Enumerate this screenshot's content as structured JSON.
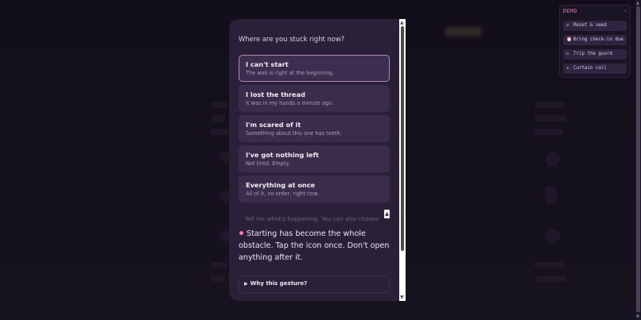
{
  "modal": {
    "question": "Where are you stuck right now?",
    "options": [
      {
        "title": "I can't start",
        "subtitle": "The wall is right at the beginning."
      },
      {
        "title": "I lost the thread",
        "subtitle": "It was in my hands a minute ago."
      },
      {
        "title": "I'm scared of it",
        "subtitle": "Something about this one has teeth."
      },
      {
        "title": "I've got nothing left",
        "subtitle": "Not tired. Empty."
      },
      {
        "title": "Everything at once",
        "subtitle": "All of it, no order, right now."
      }
    ],
    "textarea_placeholder": "Tell me what's happening. You can also choose",
    "response": "Starting has become the whole obstacle. Tap the icon once. Don't open anything after it.",
    "why_label": "Why this gesture?",
    "colors": {
      "accent_dot": "#ff6fb1",
      "selected_border": "#b885b8"
    }
  },
  "demo": {
    "label": "DEMO",
    "minimize_icon": "minus-icon",
    "buttons": [
      {
        "icon": "reset-icon",
        "glyph": "↺",
        "label": "Reset & seed"
      },
      {
        "icon": "alarm-icon",
        "glyph": "⏰",
        "label": "Bring check-in due"
      },
      {
        "icon": "shield-icon",
        "glyph": "◻",
        "label": "Trip the guard"
      },
      {
        "icon": "star-icon",
        "glyph": "★",
        "label": "Curtain call"
      }
    ]
  }
}
